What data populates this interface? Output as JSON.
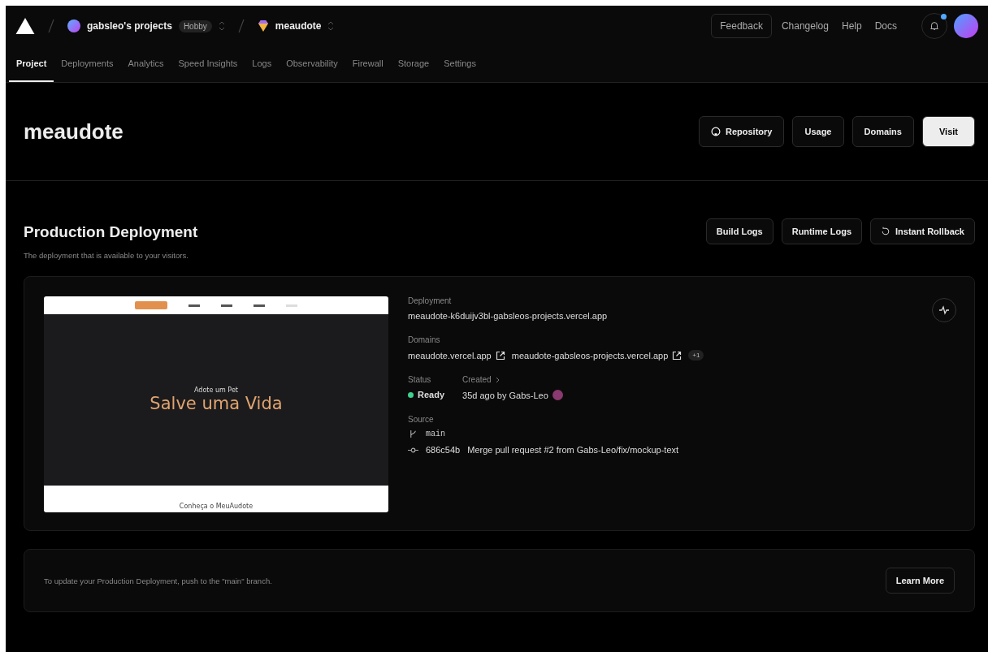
{
  "topbar": {
    "team": "gabsleo's projects",
    "plan": "Hobby",
    "project": "meaudote",
    "links": [
      "Feedback",
      "Changelog",
      "Help",
      "Docs"
    ],
    "notification_unread": true
  },
  "tabs": [
    {
      "label": "Project",
      "selected": true
    },
    {
      "label": "Deployments",
      "selected": false
    },
    {
      "label": "Analytics",
      "selected": false
    },
    {
      "label": "Speed Insights",
      "selected": false
    },
    {
      "label": "Logs",
      "selected": false
    },
    {
      "label": "Observability",
      "selected": false
    },
    {
      "label": "Firewall",
      "selected": false
    },
    {
      "label": "Storage",
      "selected": false
    },
    {
      "label": "Settings",
      "selected": false
    }
  ],
  "header": {
    "title": "meaudote",
    "buttons": [
      {
        "label": "Repository",
        "kind": "repo"
      },
      {
        "label": "Usage",
        "kind": "plain"
      },
      {
        "label": "Domains",
        "kind": "plain"
      },
      {
        "label": "Visit",
        "kind": "primary"
      }
    ]
  },
  "production": {
    "title": "Production Deployment",
    "subtitle": "The deployment that is available to your visitors.",
    "buttons": [
      {
        "label": "Build Logs",
        "kind": "plain"
      },
      {
        "label": "Runtime Logs",
        "kind": "plain"
      },
      {
        "label": "Instant Rollback",
        "kind": "rollback"
      }
    ],
    "preview": {
      "kicker": "Adote um Pet",
      "headline": "Salve uma Vida",
      "footer": "Conheça o MeuAudote"
    },
    "deployment_label": "Deployment",
    "deployment_url": "meaudote-k6duijv3bl-gabsleos-projects.vercel.app",
    "domains_label": "Domains",
    "domains": [
      "meaudote.vercel.app",
      "meaudote-gabsleos-projects.vercel.app"
    ],
    "domains_more": "+1",
    "status_label": "Status",
    "status": "Ready",
    "created_label": "Created",
    "created": "35d ago by Gabs-Leo",
    "source_label": "Source",
    "branch": "main",
    "commit_hash": "686c54b",
    "commit_message": "Merge pull request #2 from Gabs-Leo/fix/mockup-text"
  },
  "footer": {
    "text": "To update your Production Deployment, push to the \"main\" branch.",
    "button": "Learn More"
  }
}
